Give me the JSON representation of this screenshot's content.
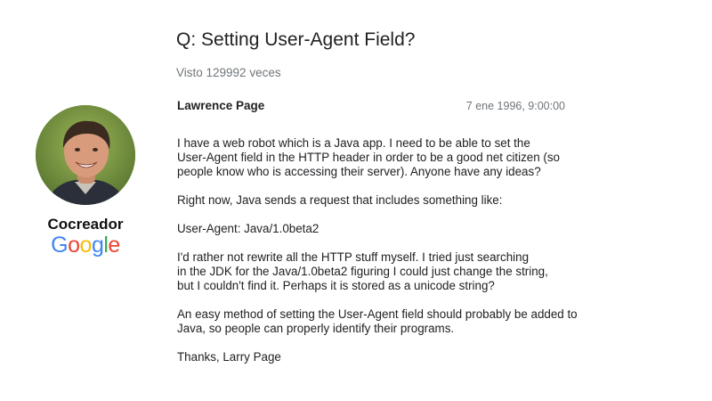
{
  "question": {
    "title": "Q: Setting User-Agent Field?",
    "views": "Visto 129992 veces"
  },
  "post": {
    "author": "Lawrence Page",
    "date": "7 ene 1996, 9:00:00",
    "paragraphs": [
      [
        "I have a web robot which is a Java app. I need to be able to set the",
        "User-Agent field in the HTTP header in order to be a good net citizen (so",
        "people know who is accessing their server). Anyone have any ideas?"
      ],
      [
        "Right now, Java sends a request that includes something like:"
      ],
      [
        "User-Agent: Java/1.0beta2"
      ],
      [
        "I'd rather not rewrite all the HTTP stuff myself. I tried just searching",
        "in the JDK for the Java/1.0beta2 figuring I could just change the string,",
        "but I couldn't find it. Perhaps it is stored as a unicode string?"
      ],
      [
        "An easy method of setting the User-Agent field should probably be added to",
        "Java, so people can properly identify their programs."
      ],
      [
        "Thanks, Larry Page"
      ]
    ]
  },
  "sidebar": {
    "role": "Cocreador",
    "logo": {
      "letters": [
        "G",
        "o",
        "o",
        "g",
        "l",
        "e"
      ],
      "colors": [
        "#4285F4",
        "#EA4335",
        "#FBBC05",
        "#4285F4",
        "#34A853",
        "#EA4335"
      ]
    }
  }
}
